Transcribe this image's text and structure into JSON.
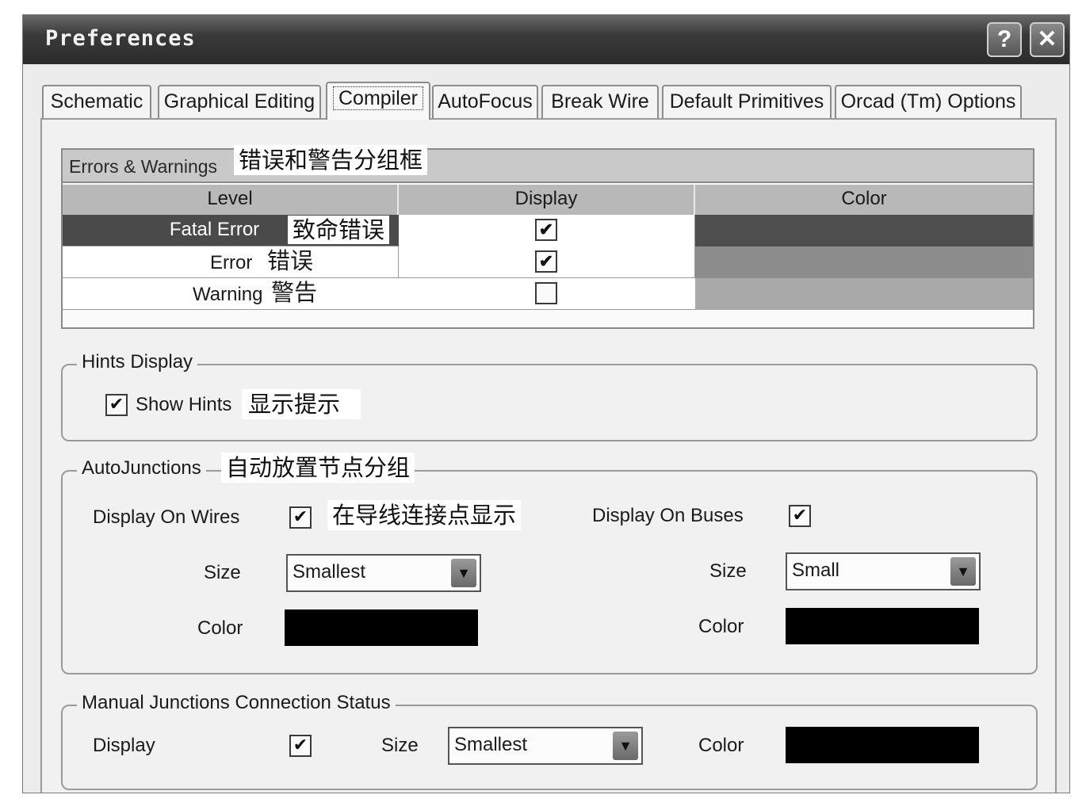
{
  "window": {
    "title": "Preferences"
  },
  "titlebar": {
    "help_label": "?",
    "close_label": "✕"
  },
  "tabs": [
    {
      "label": "Schematic"
    },
    {
      "label": "Graphical Editing"
    },
    {
      "label": "Compiler",
      "active": true
    },
    {
      "label": "AutoFocus"
    },
    {
      "label": "Break Wire"
    },
    {
      "label": "Default Primitives"
    },
    {
      "label": "Orcad (Tm) Options"
    }
  ],
  "errors": {
    "title": "Errors & Warnings",
    "annotation": "错误和警告分组框",
    "columns": {
      "level": "Level",
      "display": "Display",
      "color": "Color"
    },
    "rows": [
      {
        "level": "Fatal Error",
        "annotation": "致命错误",
        "display": true,
        "color": "#5e5e5e",
        "row_bg": "#4a4a4a",
        "text_color": "#ffffff"
      },
      {
        "level": "Error",
        "annotation": "错误",
        "display": true,
        "color": "#8d8d8d",
        "row_bg": "#ffffff",
        "text_color": "#1a1a1a"
      },
      {
        "level": "Warning",
        "annotation": "警告",
        "display": false,
        "color": "#a9a9a9",
        "row_bg": "#ffffff",
        "text_color": "#1a1a1a"
      }
    ]
  },
  "hints": {
    "group_label": "Hints Display",
    "show_hints_label": "Show Hints",
    "show_hints_checked": true,
    "annotation": "显示提示"
  },
  "auto_junctions": {
    "group_label": "AutoJunctions",
    "annotation": "自动放置节点分组",
    "wires": {
      "label": "Display On Wires",
      "checked": true,
      "annotation": "在导线连接点显示",
      "size_label": "Size",
      "size_value": "Smallest",
      "color_label": "Color",
      "color": "#000000"
    },
    "buses": {
      "label": "Display On Buses",
      "checked": true,
      "size_label": "Size",
      "size_value": "Small",
      "color_label": "Color",
      "color": "#000000"
    }
  },
  "manual_junctions": {
    "group_label": "Manual Junctions Connection Status",
    "display_label": "Display",
    "display_checked": true,
    "size_label": "Size",
    "size_value": "Smallest",
    "color_label": "Color",
    "color": "#000000"
  },
  "icons": {
    "check": "✔",
    "dropdown": "chevron-down-icon"
  }
}
